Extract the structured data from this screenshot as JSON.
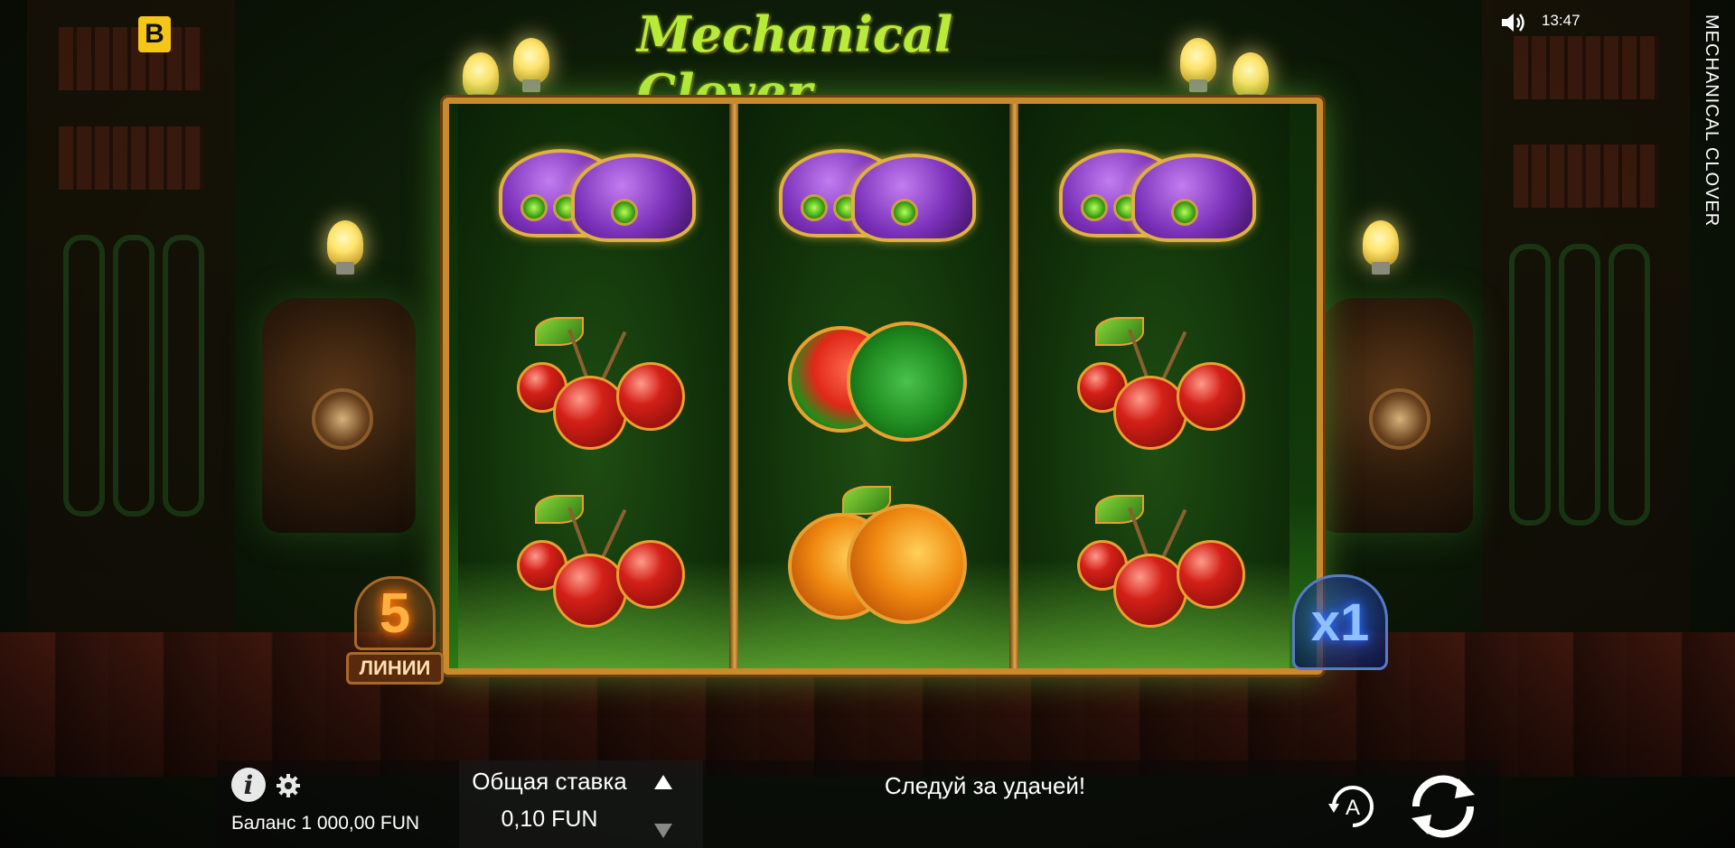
{
  "game": {
    "title_logo": "Mechanical Clover",
    "vertical_title": "MECHANICAL CLOVER",
    "brand_logo": "B"
  },
  "status": {
    "time": "13:47",
    "sound_icon": "speaker-volume-icon"
  },
  "reels": [
    [
      "purple-hats",
      "cherries",
      "cherries"
    ],
    [
      "purple-hats",
      "watermelon",
      "oranges"
    ],
    [
      "purple-hats",
      "cherries",
      "cherries"
    ]
  ],
  "lines": {
    "count": "5",
    "label": "ЛИНИИ"
  },
  "multiplier": {
    "value": "x1"
  },
  "bottom_bar": {
    "info_icon": "info-icon",
    "settings_icon": "gear-icon",
    "balance": "Баланс 1 000,00 FUN",
    "bet_label": "Общая ставка",
    "bet_value": "0,10 FUN",
    "message": "Следуй за удачей!",
    "autoplay_letter": "A"
  },
  "colors": {
    "lines_glow": "#ffb040",
    "multiplier_glow": "#8ec0ff",
    "reel_frame": "#c88a2a",
    "title_green": "#b8ea3a"
  }
}
